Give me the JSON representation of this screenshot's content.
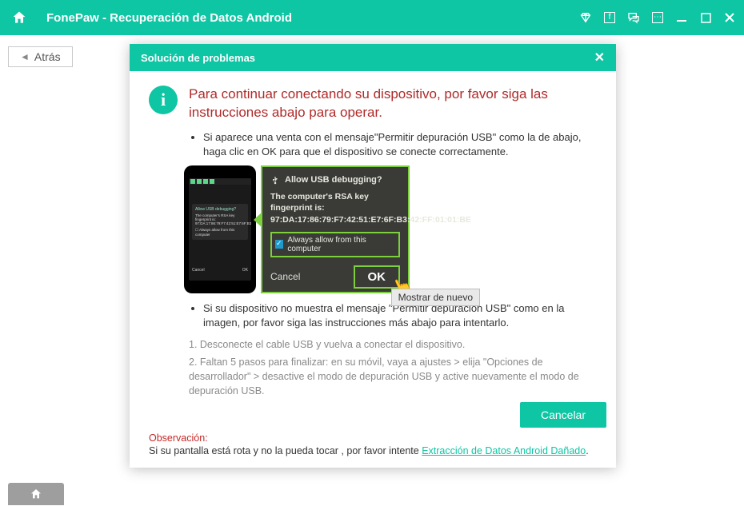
{
  "titlebar": {
    "title": "FonePaw - Recuperación de Datos Android"
  },
  "back_label": "Atrás",
  "dialog": {
    "header": "Solución de problemas",
    "headline": "Para continuar conectando su dispositivo, por favor siga las instrucciones abajo para operar.",
    "bullet1": "Si aparece  una venta con el mensaje\"Permitir depuración USB\" como la de abajo, haga clic en OK para que el dispositivo se conecte correctamente.",
    "bullet2": "Si su dispositivo no muestra el mensaje \"Permitir depuración USB\" como en la imagen, por favor siga las instrucciones más abajo para intentarlo.",
    "step1": "1. Desconecte el cable USB y vuelva a conectar el dispositivo.",
    "step2": "2. Faltan 5 pasos para finalizar: en su móvil, vaya a ajustes > elija \"Opciones de desarrollador\" > desactive el modo de depuración USB y active nuevamente el modo de depuración USB.",
    "note_label": "Observación:",
    "note_text_prefix": "Si su pantalla está rota y no la pueda tocar , por favor intente ",
    "note_link": "Extracción de Datos Android Dañado",
    "note_text_suffix": ".",
    "cancel": "Cancelar",
    "show_again": "Mostrar de nuevo"
  },
  "zoom": {
    "title": "Allow USB debugging?",
    "fp_label": "The computer's RSA key fingerprint is:",
    "fp_value": "97:DA:17:86:79:F7:42:51:E7:6F:B3:42:FF:01:01:BE",
    "always": "Always allow from this computer",
    "cancel": "Cancel",
    "ok": "OK"
  },
  "phone": {
    "popup_title": "Allow USB debugging?",
    "popup_body": "The computer's RSA key fingerprint is: 97:DA:17:86:79:F7:42:51:E7:6F:B3:42:FF:01:01:BE",
    "always": "Always allow from this computer",
    "cancel": "Cancel",
    "ok": "OK"
  }
}
